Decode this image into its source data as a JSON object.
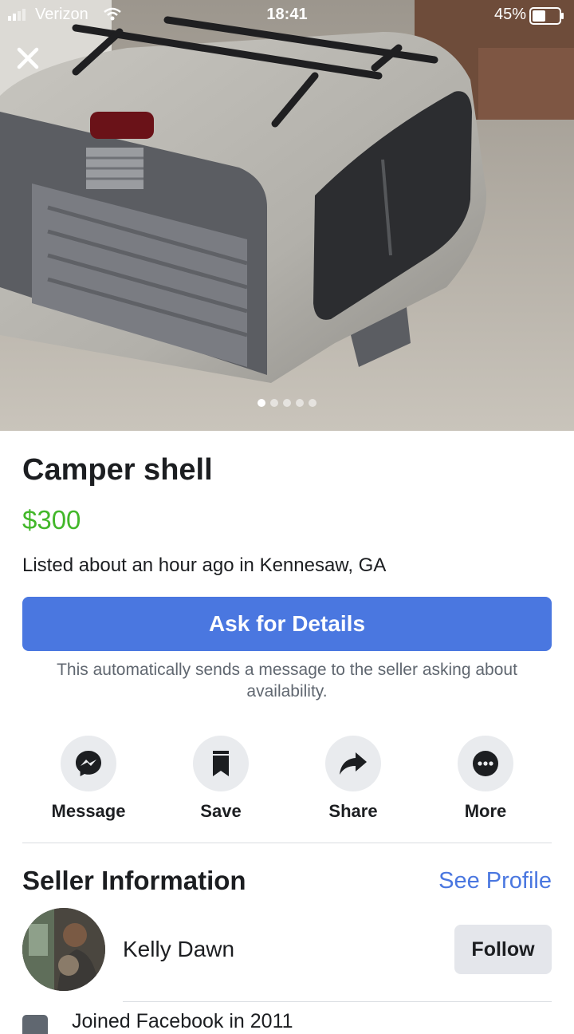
{
  "status_bar": {
    "carrier": "Verizon",
    "time": "18:41",
    "battery_percent": "45%"
  },
  "photo": {
    "current_index": 1,
    "total": 5
  },
  "listing": {
    "title": "Camper shell",
    "price": "$300",
    "listed_text": "Listed about an hour ago in Kennesaw, GA",
    "price_color": "#42b72a"
  },
  "ask": {
    "button_label": "Ask for Details",
    "note": "This automatically sends a message to the seller asking about availability.",
    "button_color": "#4a77e0"
  },
  "actions": [
    {
      "label": "Message",
      "icon": "messenger-icon"
    },
    {
      "label": "Save",
      "icon": "bookmark-icon"
    },
    {
      "label": "Share",
      "icon": "share-arrow-icon"
    },
    {
      "label": "More",
      "icon": "more-dots-icon"
    }
  ],
  "seller": {
    "heading": "Seller Information",
    "see_profile_label": "See Profile",
    "name": "Kelly Dawn",
    "follow_label": "Follow",
    "joined_text": "Joined Facebook in 2011"
  }
}
